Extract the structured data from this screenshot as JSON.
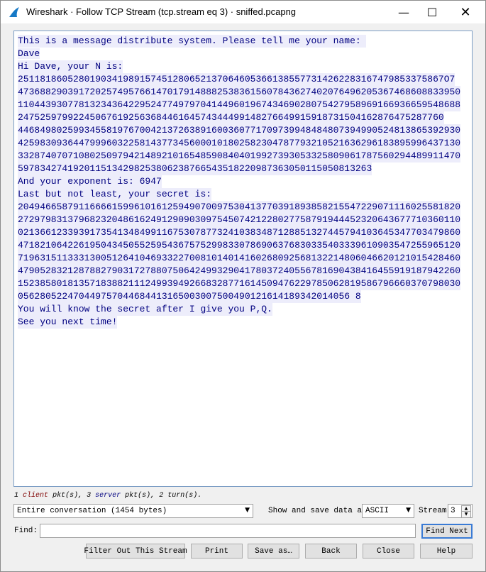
{
  "window": {
    "title": "Wireshark · Follow TCP Stream (tcp.stream eq 3) · sniffed.pcapng",
    "minimize_glyph": "—",
    "maximize_glyph": "☐",
    "close_glyph": "✕"
  },
  "stream": {
    "lines": [
      {
        "who": "server",
        "text": "This is a message distribute system. Please tell me your name: "
      },
      {
        "who": "client",
        "text": "Dave"
      },
      {
        "who": "server",
        "text": "Hi Dave, your N is:"
      },
      {
        "who": "server",
        "text": "25118186052801903419891574512806521370646053661385577314262283167479853375867O7"
      },
      {
        "who": "server",
        "text": "47368829039172025749576614701791488825383615607843627402076496205367468608833950"
      },
      {
        "who": "server",
        "text": "11044393077813234364229524774979704144960196743469028075427958969166936659548688"
      },
      {
        "who": "server",
        "text": "24752597992245067619256368446164574344499148276649915918731504162876475287760"
      },
      {
        "who": "server",
        "text": "44684980259934558197670042137263891600360771709739948484807394990524813865392930"
      },
      {
        "who": "server",
        "text": "42598309364479996032258143773456000101802582304787793210521636296183895996437130"
      },
      {
        "who": "server",
        "text": "33287407071080250979421489210165485908404019927393053325809061787560294489911470"
      },
      {
        "who": "server",
        "text": "5978342741920115134298253806238766543518220987363050115050813263"
      },
      {
        "who": "server",
        "text": "And your exponent is: 6947"
      },
      {
        "who": "server",
        "text": "Last but not least, your secret is:"
      },
      {
        "who": "server",
        "text": "20494665879116666159961016125949070097530413770391893858215547229071116025581820"
      },
      {
        "who": "server",
        "text": "27297983137968232048616249129090309754507421228027758791944452320643677710360110"
      },
      {
        "who": "server",
        "text": "02136612339391735413484991167530787732410383487128851327445794103645347703479860"
      },
      {
        "who": "server",
        "text": "47182106422619504345055259543675752998330786906376830335403339610903547255965120"
      },
      {
        "who": "server",
        "text": "71963151133313005126410469332270081014014160268092568132214806046620121015428460"
      },
      {
        "who": "server",
        "text": "47905283212878827903172788075064249932904178037240556781690438416455919187942260"
      },
      {
        "who": "server",
        "text": "15238580181357183882111249939492668328771614509476229785062819586796660370798030"
      },
      {
        "who": "server",
        "text": "056280522470449757044684413165003007500490121614189342014056 8"
      },
      {
        "who": "server",
        "text": "You will know the secret after I give you P,Q."
      },
      {
        "who": "server",
        "text": "See you next time!"
      }
    ]
  },
  "stats": {
    "client_count": "1",
    "client_word": "client",
    "pkt1": "pkt(s),",
    "server_count": "3",
    "server_word": "server",
    "pkt2": "pkt(s),",
    "turns": "2 turn(s)."
  },
  "controls": {
    "conversation": "Entire conversation (1454 bytes)",
    "show_label": "Show and save data as",
    "format": "ASCII",
    "stream_label": "Stream",
    "stream_value": "3",
    "find_label": "Find:",
    "find_value": "",
    "find_next": "Find Next",
    "filter_out": "Filter Out This Stream",
    "print": "Print",
    "save_as": "Save as…",
    "back": "Back",
    "close": "Close",
    "help": "Help"
  }
}
